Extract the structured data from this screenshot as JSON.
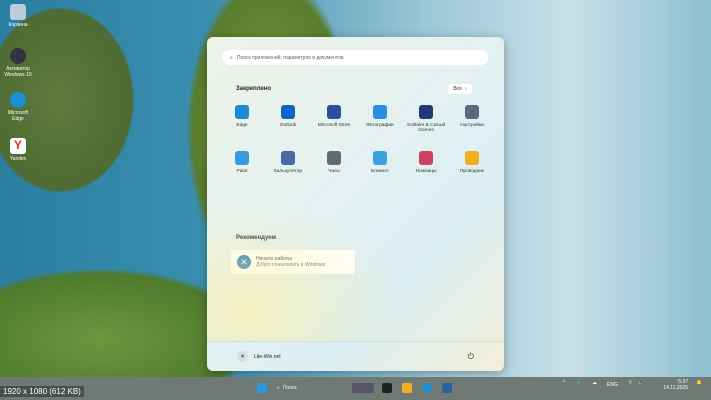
{
  "desktop": {
    "icons": [
      {
        "label": "Корзина",
        "color": "#bcd"
      },
      {
        "label": "Активатор Windows 10",
        "color": "#334"
      },
      {
        "label": "Microsoft Edge",
        "color": "#1a8fd0"
      },
      {
        "label": "Yandex",
        "color": "#e03030"
      }
    ]
  },
  "start": {
    "search_placeholder": "Поиск приложений, параметров и документов",
    "pinned_title": "Закреплено",
    "all_label": "Все",
    "apps": [
      {
        "label": "Edge",
        "color": "#1b8ad6"
      },
      {
        "label": "Outlook",
        "color": "#0a64c0"
      },
      {
        "label": "Microsoft Store",
        "color": "#2a4fa0"
      },
      {
        "label": "Фотографии",
        "color": "#2a8fe0"
      },
      {
        "label": "Solitaire & Casual Games",
        "color": "#1e3a70"
      },
      {
        "label": "Настройки",
        "color": "#5a6a80"
      },
      {
        "label": "Paint",
        "color": "#3a9ae0"
      },
      {
        "label": "Калькулятор",
        "color": "#4a6aa0"
      },
      {
        "label": "Часы",
        "color": "#606870"
      },
      {
        "label": "Блокнот",
        "color": "#3aa0e0"
      },
      {
        "label": "Ножницы",
        "color": "#d04060"
      },
      {
        "label": "Проводник",
        "color": "#f0b020"
      }
    ],
    "recommended_title": "Рекомендуем",
    "rec_item": {
      "title": "Начало работы",
      "subtitle": "Добро пожаловать в Windows"
    },
    "user": "Lite-Win.net"
  },
  "taskbar": {
    "search": "Поиск",
    "lang": "ENG",
    "time": "5:37",
    "date": "14.11.2025"
  },
  "overlay": "1920 x 1080 (612 KB)"
}
